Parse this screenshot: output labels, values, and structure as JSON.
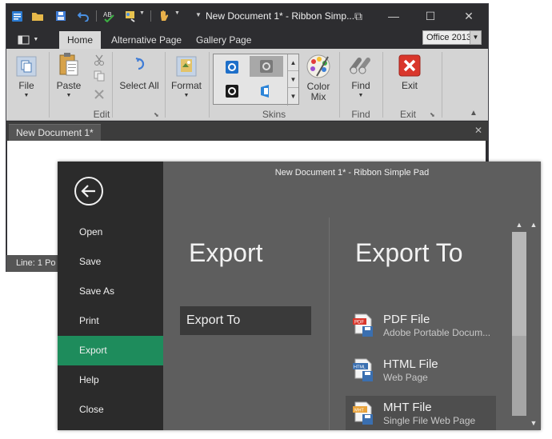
{
  "window": {
    "title": "New Document 1* - Ribbon Simple Pad",
    "title_short": "New Document 1* - Ribbon Simp...",
    "controls": {
      "minimize": "—",
      "maximize": "☐",
      "close": "✕",
      "restore_down": "⧉"
    }
  },
  "ribbon": {
    "tabs": [
      {
        "label": "Home",
        "active": true
      },
      {
        "label": "Alternative Page",
        "active": false
      },
      {
        "label": "Gallery Page",
        "active": false
      }
    ],
    "skin_selector": "Office 2013",
    "buttons": {
      "file": "File",
      "paste": "Paste",
      "select_all": "Select All",
      "format": "Format",
      "color_mix_1": "Color",
      "color_mix_2": "Mix",
      "find": "Find",
      "exit": "Exit"
    },
    "groups": {
      "edit": "Edit",
      "skins": "Skins",
      "find": "Find",
      "exit": "Exit"
    }
  },
  "document": {
    "tab_label": "New Document 1*",
    "status": "Line: 1  Po"
  },
  "backstage": {
    "title": "New Document 1* - Ribbon Simple Pad",
    "nav": [
      {
        "label": "Open",
        "selected": false
      },
      {
        "label": "Save",
        "selected": false
      },
      {
        "label": "Save As",
        "selected": false
      },
      {
        "label": "Print",
        "selected": false
      },
      {
        "label": "Export",
        "selected": true
      },
      {
        "label": "Help",
        "selected": false
      },
      {
        "label": "Close",
        "selected": false
      }
    ],
    "heading": "Export",
    "sub_item": "Export To",
    "right_heading": "Export To",
    "export_items": [
      {
        "name": "PDF File",
        "desc": "Adobe Portable Docum...",
        "badge": "PDF"
      },
      {
        "name": "HTML File",
        "desc": "Web Page",
        "badge": "HTML"
      },
      {
        "name": "MHT File",
        "desc": "Single File Web Page",
        "badge": "MHT"
      }
    ]
  },
  "colors": {
    "accent": "#1e8c5c",
    "titlebar": "#2d2d30",
    "ribbon": "#d4d4d4",
    "backstage_nav": "#2b2b2b",
    "backstage_content": "#5e5e5e",
    "exit_red": "#d9362b"
  }
}
